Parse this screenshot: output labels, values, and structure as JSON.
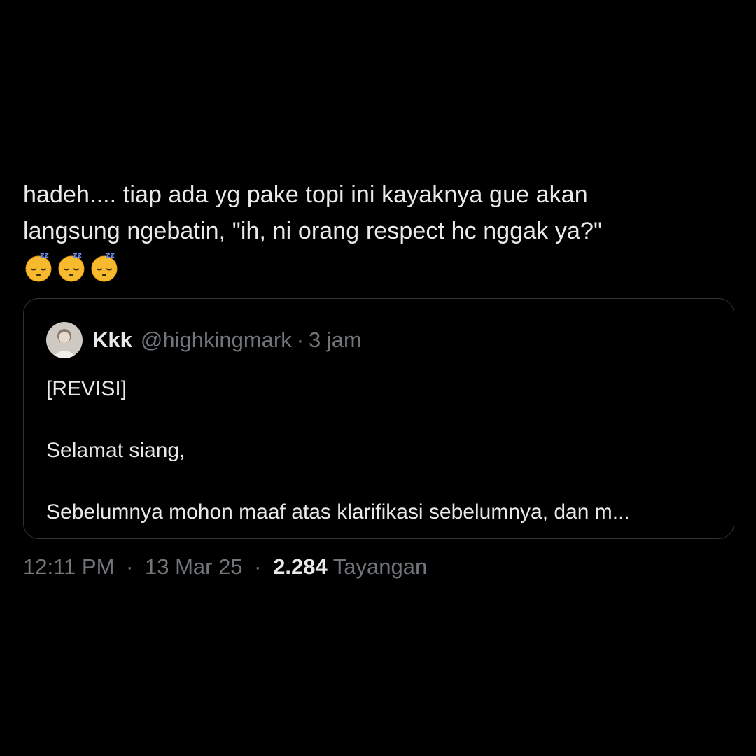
{
  "tweet": {
    "text_line1": "hadeh.... tiap ada yg pake topi ini kayaknya gue akan",
    "text_line2": "langsung ngebatin, \"ih, ni orang respect hc nggak ya?\"",
    "emoji": [
      "sleeping-face",
      "sleeping-face",
      "sleeping-face"
    ]
  },
  "quote": {
    "display_name": "Kkk",
    "handle": "@highkingmark",
    "separator": "·",
    "time_ago": "3 jam",
    "body": [
      "[REVISI]",
      "Selamat siang,",
      "Sebelumnya mohon maaf atas klarifikasi sebelumnya, dan m..."
    ]
  },
  "meta": {
    "time": "12:11 PM",
    "date": "13 Mar 25",
    "separator": "·",
    "views_count": "2.284",
    "views_label": "Tayangan"
  },
  "colors": {
    "background": "#000000",
    "primary_text": "#e7e9ea",
    "secondary_text": "#71767b",
    "border": "#2f3336"
  }
}
